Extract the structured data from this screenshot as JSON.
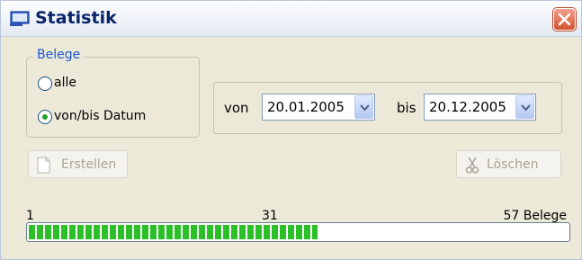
{
  "window": {
    "title": "Statistik",
    "close_icon": "close-icon"
  },
  "belege_group": {
    "legend": "Belege",
    "options": [
      {
        "label": "alle",
        "selected": false
      },
      {
        "label": "von/bis Datum",
        "selected": true
      }
    ]
  },
  "date_range": {
    "from_label": "von",
    "from_value": "20.01.2005",
    "to_label": "bis",
    "to_value": "20.12.2005"
  },
  "buttons": {
    "create_label": "Erstellen",
    "create_enabled": false,
    "delete_label": "Löschen",
    "delete_enabled": false
  },
  "progress": {
    "min_label": "1",
    "current_label": "31",
    "max_label": "57 Belege",
    "min": 1,
    "current": 31,
    "max": 57
  },
  "colors": {
    "progress_fill": "#2bc028",
    "group_legend": "#1e55d4",
    "title": "#0a246a"
  }
}
